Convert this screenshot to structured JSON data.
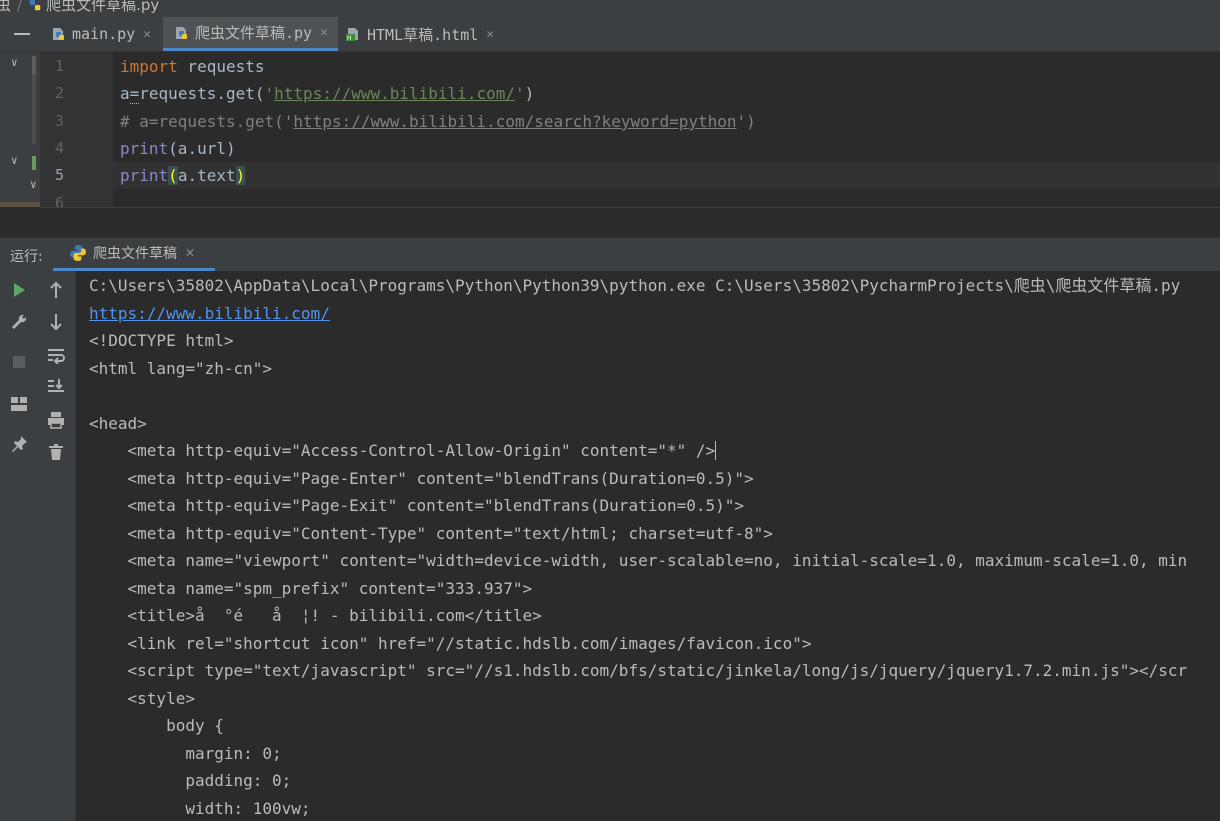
{
  "breadcrumb": {
    "project": "虫",
    "file": "爬虫文件草稿.py"
  },
  "tabs": [
    {
      "label": "main.py",
      "active": false,
      "icon": "python-file-icon"
    },
    {
      "label": "爬虫文件草稿.py",
      "active": true,
      "icon": "python-file-icon"
    },
    {
      "label": "HTML草稿.html",
      "active": false,
      "icon": "html-file-icon"
    }
  ],
  "editor": {
    "line_numbers": [
      "1",
      "2",
      "3",
      "4",
      "5",
      "6"
    ],
    "lines": {
      "l1_kw": "import",
      "l1_rest": " requests",
      "l2_a": "a",
      "l2_eq": "=",
      "l2_call": "requests.get(",
      "l2_q1": "'",
      "l2_url": "https://www.bilibili.com/",
      "l2_q2": "'",
      "l2_end": ")",
      "l3_pre": "# a=requests.get('",
      "l3_url": "https://www.bilibili.com/search?keyword=python",
      "l3_post": "')",
      "l4_kw": "print",
      "l4_rest": "(a.url)",
      "l5_kw": "print",
      "l5_open": "(",
      "l5_mid": "a.text",
      "l5_close": ")"
    }
  },
  "run_panel": {
    "label": "运行:",
    "tab_label": "爬虫文件草稿"
  },
  "console": {
    "lines": [
      "C:\\Users\\35802\\AppData\\Local\\Programs\\Python\\Python39\\python.exe C:\\Users\\35802\\PycharmProjects\\爬虫\\爬虫文件草稿.py",
      "https://www.bilibili.com/",
      "<!DOCTYPE html>",
      "<html lang=\"zh-cn\">",
      "",
      "<head>",
      "    <meta http-equiv=\"Access-Control-Allow-Origin\" content=\"*\" />",
      "    <meta http-equiv=\"Page-Enter\" content=\"blendTrans(Duration=0.5)\">",
      "    <meta http-equiv=\"Page-Exit\" content=\"blendTrans(Duration=0.5)\">",
      "    <meta http-equiv=\"Content-Type\" content=\"text/html; charset=utf-8\">",
      "    <meta name=\"viewport\" content=\"width=device-width, user-scalable=no, initial-scale=1.0, maximum-scale=1.0, min",
      "    <meta name=\"spm_prefix\" content=\"333.937\">",
      "    <title>å  °é   å  ¦! - bilibili.com</title>",
      "    <link rel=\"shortcut icon\" href=\"//static.hdslb.com/images/favicon.ico\">",
      "    <script type=\"text/javascript\" src=\"//s1.hdslb.com/bfs/static/jinkela/long/js/jquery/jquery1.7.2.min.js\"></scr",
      "    <style>",
      "        body {",
      "          margin: 0;",
      "          padding: 0;",
      "          width: 100vw;"
    ]
  },
  "colors": {
    "background": "#2b2b2b",
    "panel": "#3c3f41",
    "keyword": "#cc7832",
    "string": "#6a8759",
    "comment": "#808080",
    "link": "#5394ec",
    "accent": "#4a88c7",
    "run_green": "#59a869"
  },
  "icons": {
    "run": "run-icon",
    "wrench": "wrench-icon",
    "stop": "stop-icon",
    "layout": "layout-icon",
    "pin": "pin-icon",
    "up": "arrow-up-icon",
    "down": "arrow-down-icon",
    "wrap": "soft-wrap-icon",
    "scroll": "scroll-to-end-icon",
    "print": "print-icon",
    "trash": "trash-icon"
  }
}
